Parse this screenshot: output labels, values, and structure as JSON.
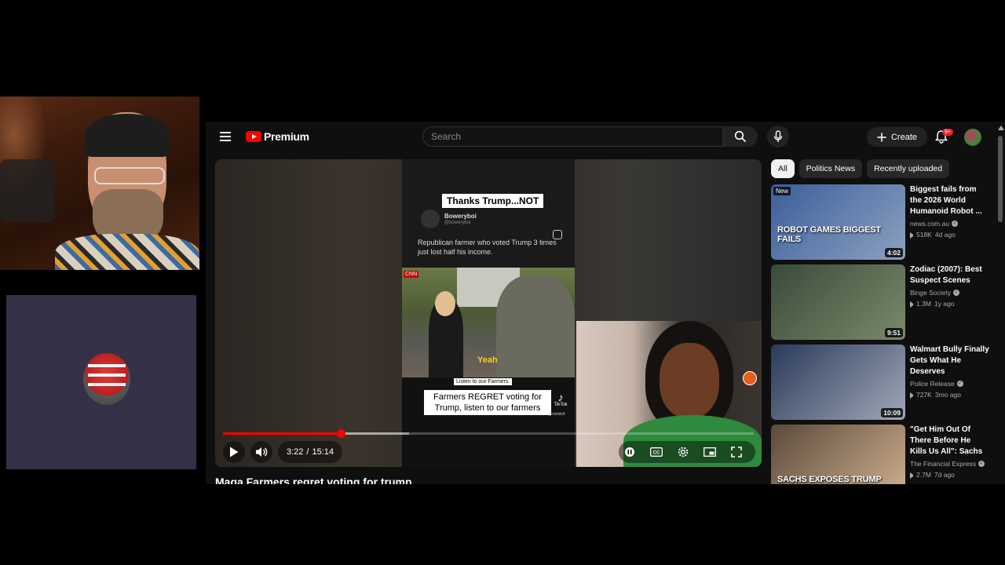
{
  "header": {
    "logo_text": "Premium",
    "search_placeholder": "Search",
    "create_label": "Create",
    "notification_count": "9+"
  },
  "player": {
    "current_time": "3:22",
    "duration": "15:14",
    "time_separator": "/",
    "progress_fraction": 0.222,
    "buffered_fraction": 0.351,
    "video_title": "Maga Farmers regret voting for trump"
  },
  "embedded_video": {
    "top_caption": "Thanks Trump...NOT",
    "tweet_author": "Boweryboi",
    "tweet_handle": "@boweryboi",
    "tweet_text": "Republican farmer who voted Trump 3 times just lost half his income.",
    "scene_network": "CNN",
    "scene_subtitle": "Yeah",
    "small_caption": "Listen to our Farmers.",
    "main_caption": "Farmers REGRET voting for Trump, listen to our farmers",
    "tiktok_label": "TikTok",
    "tiktok_handle": "@romdcfr"
  },
  "chips": [
    {
      "label": "All",
      "active": true
    },
    {
      "label": "Politics News",
      "active": false
    },
    {
      "label": "Recently uploaded",
      "active": false
    }
  ],
  "recommendations": [
    {
      "title": "Biggest fails from the 2026 World Humanoid Robot ...",
      "channel": "news.com.au",
      "views": "518K",
      "age": "4d ago",
      "duration": "4:02",
      "badge": "New",
      "thumb_text": "ROBOT GAMES BIGGEST FAILS",
      "thumb_colors": [
        "#3b5f9a",
        "#8da0c0"
      ]
    },
    {
      "title": "Zodiac (2007): Best Suspect Scenes",
      "channel": "Binge Society",
      "views": "1.3M",
      "age": "1y ago",
      "duration": "9:51",
      "badge": "",
      "thumb_text": "",
      "thumb_colors": [
        "#3a4a3a",
        "#7a8a6a"
      ]
    },
    {
      "title": "Walmart Bully Finally Gets What He Deserves",
      "channel": "Police Release",
      "views": "727K",
      "age": "3mo ago",
      "duration": "10:09",
      "badge": "",
      "thumb_text": "",
      "thumb_colors": [
        "#2a3a5a",
        "#a0a8b8"
      ]
    },
    {
      "title": "\"Get Him Out Of There Before He Kills Us All\": Sachs Trum...",
      "channel": "The Financial Express",
      "views": "2.7M",
      "age": "7d ago",
      "duration": "",
      "badge": "",
      "thumb_text": "SACHS EXPOSES TRUMP",
      "thumb_colors": [
        "#5a4a3a",
        "#d0b090"
      ]
    }
  ]
}
